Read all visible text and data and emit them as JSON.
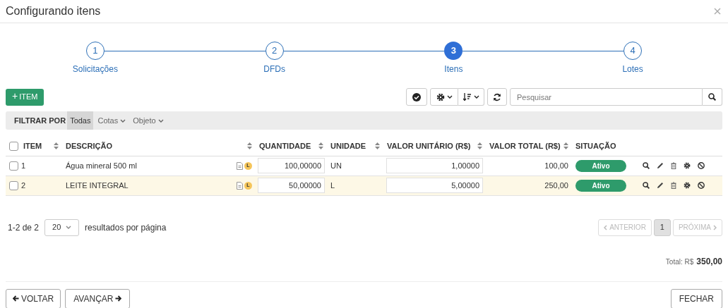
{
  "window": {
    "title": "Configurando itens"
  },
  "stepper": {
    "steps": [
      {
        "number": "1",
        "label": "Solicitações",
        "selected": false
      },
      {
        "number": "2",
        "label": "DFDs",
        "selected": false
      },
      {
        "number": "3",
        "label": "Itens",
        "selected": true
      },
      {
        "number": "4",
        "label": "Lotes",
        "selected": false
      }
    ]
  },
  "add_button": {
    "icon": "+",
    "label": "ITEM"
  },
  "search": {
    "placeholder": "Pesquisar"
  },
  "filter": {
    "label": "FILTRAR POR",
    "options": [
      {
        "label": "Todas",
        "selected": true,
        "kind": "plain"
      },
      {
        "label": "Cotas",
        "selected": false,
        "kind": "dropdown"
      },
      {
        "label": "Objeto",
        "selected": false,
        "kind": "dropdown"
      }
    ]
  },
  "table": {
    "select_all_checked": false,
    "columns": [
      {
        "label": "ITEM",
        "sortable": true
      },
      {
        "label": "DESCRIÇÃO",
        "sortable": true
      },
      {
        "label": "QUANTIDADE",
        "sortable": true
      },
      {
        "label": "UNIDADE",
        "sortable": true
      },
      {
        "label": "VALOR UNITÁRIO (R$)",
        "sortable": true
      },
      {
        "label": "VALOR TOTAL (R$)",
        "sortable": true
      },
      {
        "label": "SITUAÇÃO",
        "sortable": false
      }
    ],
    "rows": [
      {
        "checked": false,
        "highlighted": false,
        "item": "1",
        "description": "Água mineral 500 ml",
        "badge": "L",
        "quantity": "100,00000",
        "unit": "UN",
        "unit_value": "1,00000",
        "total": "100,00",
        "status": "Ativo"
      },
      {
        "checked": false,
        "highlighted": true,
        "item": "2",
        "description": "LEITE INTEGRAL",
        "badge": "L",
        "quantity": "50,00000",
        "unit": "L",
        "unit_value": "5,00000",
        "total": "250,00",
        "status": "Ativo"
      }
    ]
  },
  "pagination": {
    "range": "1-2 de 2",
    "page_size": "20",
    "per_page_label": "resultados por página",
    "previous": {
      "label": "ANTERIOR",
      "disabled": true
    },
    "pages": [
      {
        "label": "1",
        "selected": true
      }
    ],
    "next": {
      "label": "PRÓXIMA",
      "disabled": true
    }
  },
  "total": {
    "label": "Total: R$",
    "value": "350,00"
  },
  "footer": {
    "back": "VOLTAR",
    "forward": "AVANÇAR",
    "close": "FECHAR"
  }
}
